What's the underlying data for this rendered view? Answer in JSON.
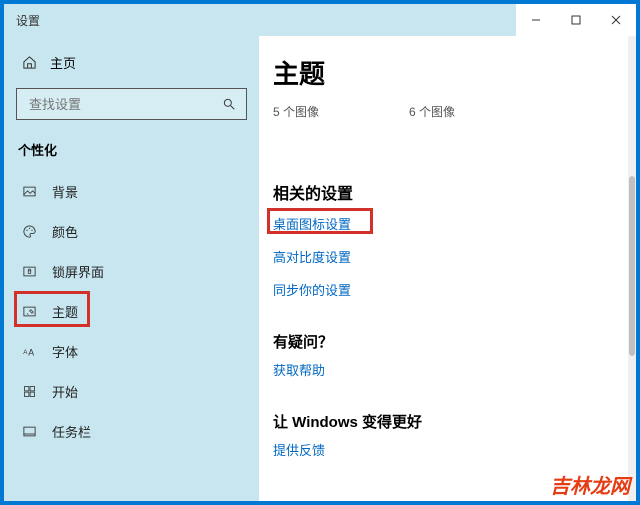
{
  "window": {
    "title": "设置"
  },
  "sidebar": {
    "home_label": "主页",
    "search_placeholder": "查找设置",
    "category": "个性化",
    "items": [
      {
        "icon": "image",
        "label": "背景"
      },
      {
        "icon": "palette",
        "label": "颜色"
      },
      {
        "icon": "lock",
        "label": "锁屏界面"
      },
      {
        "icon": "theme",
        "label": "主题"
      },
      {
        "icon": "font",
        "label": "字体"
      },
      {
        "icon": "start",
        "label": "开始"
      },
      {
        "icon": "taskbar",
        "label": "任务栏"
      }
    ]
  },
  "content": {
    "heading": "主题",
    "counts": {
      "left": "5 个图像",
      "right": "6 个图像"
    },
    "related": {
      "heading": "相关的设置",
      "links": [
        "桌面图标设置",
        "高对比度设置",
        "同步你的设置"
      ]
    },
    "help": {
      "heading": "有疑问？",
      "link": "获取帮助"
    },
    "feedback": {
      "heading": "让 Windows 变得更好",
      "link": "提供反馈"
    }
  },
  "watermark": "吉林龙网"
}
